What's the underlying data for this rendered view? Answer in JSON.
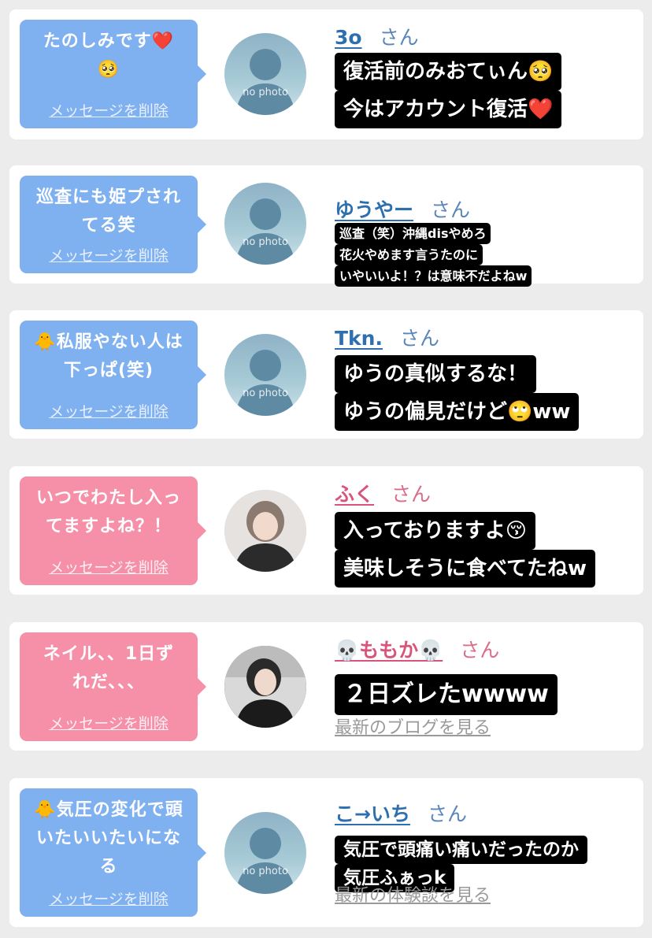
{
  "delete_label": "メッセージを削除",
  "honorific": "さん",
  "no_photo_label": "no photo",
  "colors": {
    "blue_bubble": "#7fb0f0",
    "pink_bubble": "#f590a8",
    "name_blue": "#2e6fb0",
    "name_pink": "#d9547a"
  },
  "cards": [
    {
      "bubble": "たのしみです❤️\n🥺",
      "bubble_color": "blue",
      "avatar": "no-photo",
      "name": "3o",
      "overlay": [
        "復活前のみおてぃん🥺",
        "今はアカウント復活❤️"
      ]
    },
    {
      "bubble": "巡査にも姫プされてる笑",
      "bubble_color": "blue",
      "avatar": "no-photo",
      "name": "ゆうやー",
      "overlay": [
        "巡査（笑）沖縄disやめろ",
        "花火やめます言うたのに",
        "いやいいよ！？は意味不だよねw"
      ]
    },
    {
      "bubble": "🐥私服やない人は下っぱ(笑)",
      "bubble_color": "blue",
      "avatar": "no-photo",
      "name": "Tkn.",
      "overlay": [
        "ゆうの真似するな！",
        "ゆうの偏見だけど🙄ww"
      ]
    },
    {
      "bubble": "いつでわたし入ってますよね？！",
      "bubble_color": "pink",
      "avatar": "photo",
      "name": "ふく",
      "overlay": [
        "入っておりますよ😚",
        "美味しそうに食べてたねw"
      ]
    },
    {
      "bubble": "ネイル、、1日ずれだ、、、",
      "bubble_color": "pink",
      "avatar": "photo",
      "name": "💀ももか💀",
      "overlay": [
        "２日ズレたwwww"
      ],
      "link": "最新のブログを見る"
    },
    {
      "bubble": "🐥気圧の変化で頭いたいいたいになる",
      "bubble_color": "blue",
      "avatar": "no-photo",
      "name": "こ→いち",
      "overlay": [
        "気圧で頭痛い痛いだったのか",
        "気圧ふぁっk"
      ],
      "link": "最新の体験談を見る"
    }
  ]
}
